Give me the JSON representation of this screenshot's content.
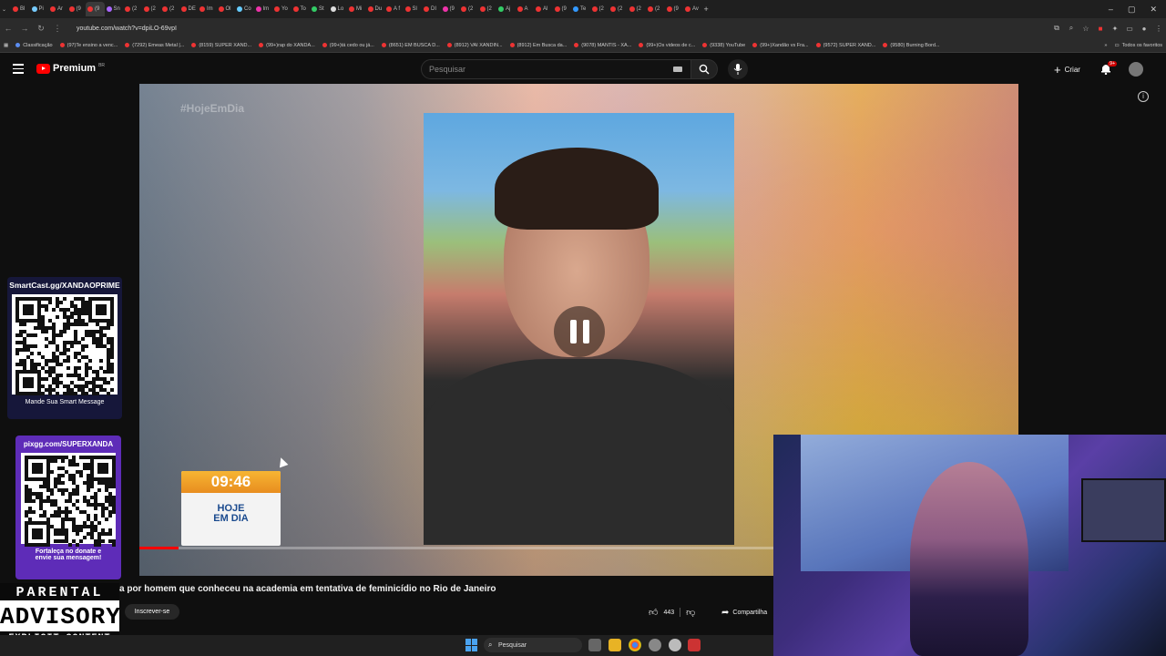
{
  "browser": {
    "url": "youtube.com/watch?v=dpiLO-69vpI",
    "tabs": [
      "Bl",
      "Pi",
      "Ar",
      "(9",
      "(9",
      "Sn",
      "(2",
      "(2",
      "(2",
      "DE",
      "Im",
      "Ol",
      "Co",
      "Im",
      "Yo",
      "To",
      "St",
      "Lo",
      "Mi",
      "Du",
      "A f",
      "Sl",
      "DI",
      "(9",
      "(2",
      "(2",
      "Aj",
      "A",
      "Al",
      "(9",
      "Te",
      "(2",
      "(2",
      "(2",
      "(2",
      "(9",
      "Av"
    ],
    "bookmarks": [
      "Classificação",
      "(97)Te ensino a venc...",
      "(7292) Emeas Metal |...",
      "(8159) SUPER XAND...",
      "(99+)rap do XANDÃ...",
      "(99+)tá cedo ou já...",
      "(8651) EM BUSCA D...",
      "(8912) VAI XANDIN...",
      "(8912) Em Busca da...",
      "(9078) MANTIS - XA...",
      "(99+)Os videos de c...",
      "(9338) YouTube",
      "(99+)Xandão vs Fra...",
      "(9572) SUPER XAND...",
      "(9580) Burning Bord..."
    ],
    "all_bookmarks_label": "Todos os favoritos",
    "window_controls": [
      "–",
      "▢",
      "✕"
    ]
  },
  "youtube": {
    "logo": "Premium",
    "logo_region": "BR",
    "search_placeholder": "Pesquisar",
    "create_label": "Criar",
    "notifications_badge": "9+"
  },
  "player": {
    "hashtag": "#HojeEmDia",
    "progress": 0.045
  },
  "clock_widget": {
    "time": "09:46",
    "brand_line1": "HOJE",
    "brand_line2": "EM DIA"
  },
  "smartcast": {
    "title": "SmartCast.gg/XANDAOPRIME",
    "caption": "Mande Sua Smart Message"
  },
  "pixgg": {
    "title": "pixgg.com/SUPERXANDA",
    "caption_line1": "Fortaleça no donate e",
    "caption_line2": "envie sua mensagem!"
  },
  "video": {
    "title": "a por homem que conheceu na academia em tentativa de feminicídio no Rio de Janeiro",
    "subscribe_label": "Inscrever-se",
    "likes": "443",
    "share_label": "Compartilha"
  },
  "parental_advisory": {
    "line1": "PARENTAL",
    "line2": "ADVISORY",
    "line3": "EXPLICIT CONTENT"
  },
  "taskbar": {
    "search_placeholder": "Pesquisar"
  },
  "colors": {
    "youtube_red": "#ff0000",
    "background": "#0f0f0f",
    "qr_panel": "#16173a",
    "clock_orange": "#f7b533",
    "brand_blue": "#1a4a8e"
  }
}
